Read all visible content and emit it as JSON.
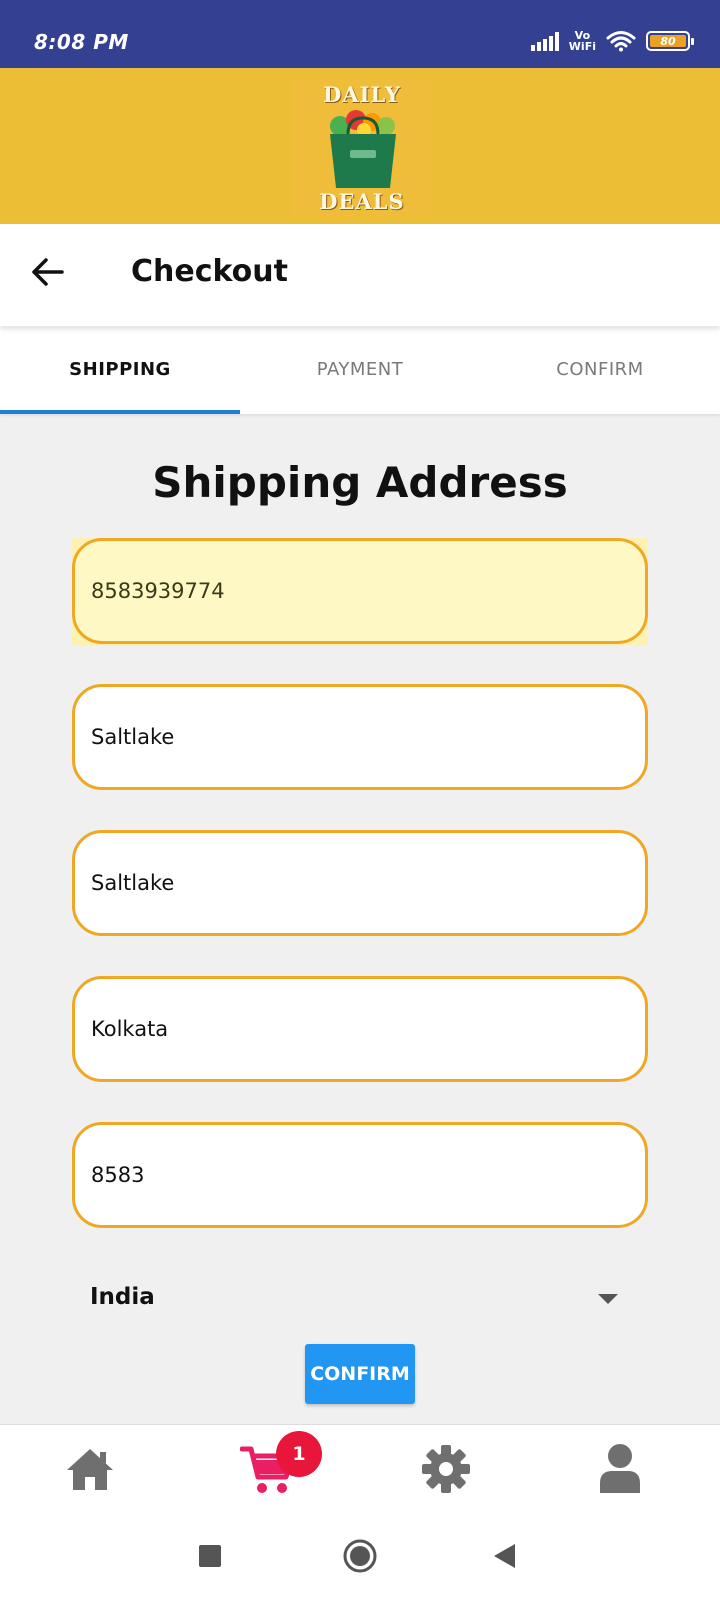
{
  "status_bar": {
    "time": "8:08 PM",
    "vowifi_line1": "Vo",
    "vowifi_line2": "WiFi",
    "battery_level": "80",
    "icons": [
      "signal-icon",
      "vowifi-icon",
      "wifi-icon",
      "battery-icon"
    ]
  },
  "brand": {
    "logo_text_top": "DAILY",
    "logo_text_bottom": "DEALS",
    "logo_icon": "grocery-bag-icon"
  },
  "header": {
    "back_icon": "back-arrow-icon",
    "title": "Checkout"
  },
  "tabs": [
    {
      "label": "SHIPPING",
      "active": true
    },
    {
      "label": "PAYMENT",
      "active": false
    },
    {
      "label": "CONFIRM",
      "active": false
    }
  ],
  "form": {
    "title": "Shipping Address",
    "fields": [
      {
        "value": "8583939774",
        "autofilled": true
      },
      {
        "value": "Saltlake",
        "autofilled": false
      },
      {
        "value": "Saltlake",
        "autofilled": false
      },
      {
        "value": "Kolkata",
        "autofilled": false
      },
      {
        "value": "8583",
        "autofilled": false
      }
    ],
    "country": "India",
    "confirm_label": "CONFIRM"
  },
  "bottom_nav": {
    "items": [
      "home-icon",
      "cart-icon",
      "settings-icon",
      "profile-icon"
    ],
    "cart_badge": "1",
    "cart_color": "#e91e63"
  },
  "system_nav": {
    "items": [
      "recents-icon",
      "home-circle-icon",
      "back-triangle-icon"
    ]
  },
  "colors": {
    "status_bar": "#344092",
    "brand_bar": "#ebbe35",
    "accent_tab": "#1e7fd8",
    "field_border": "#f0a724",
    "confirm_button": "#2196f3",
    "badge": "#e8163a"
  }
}
